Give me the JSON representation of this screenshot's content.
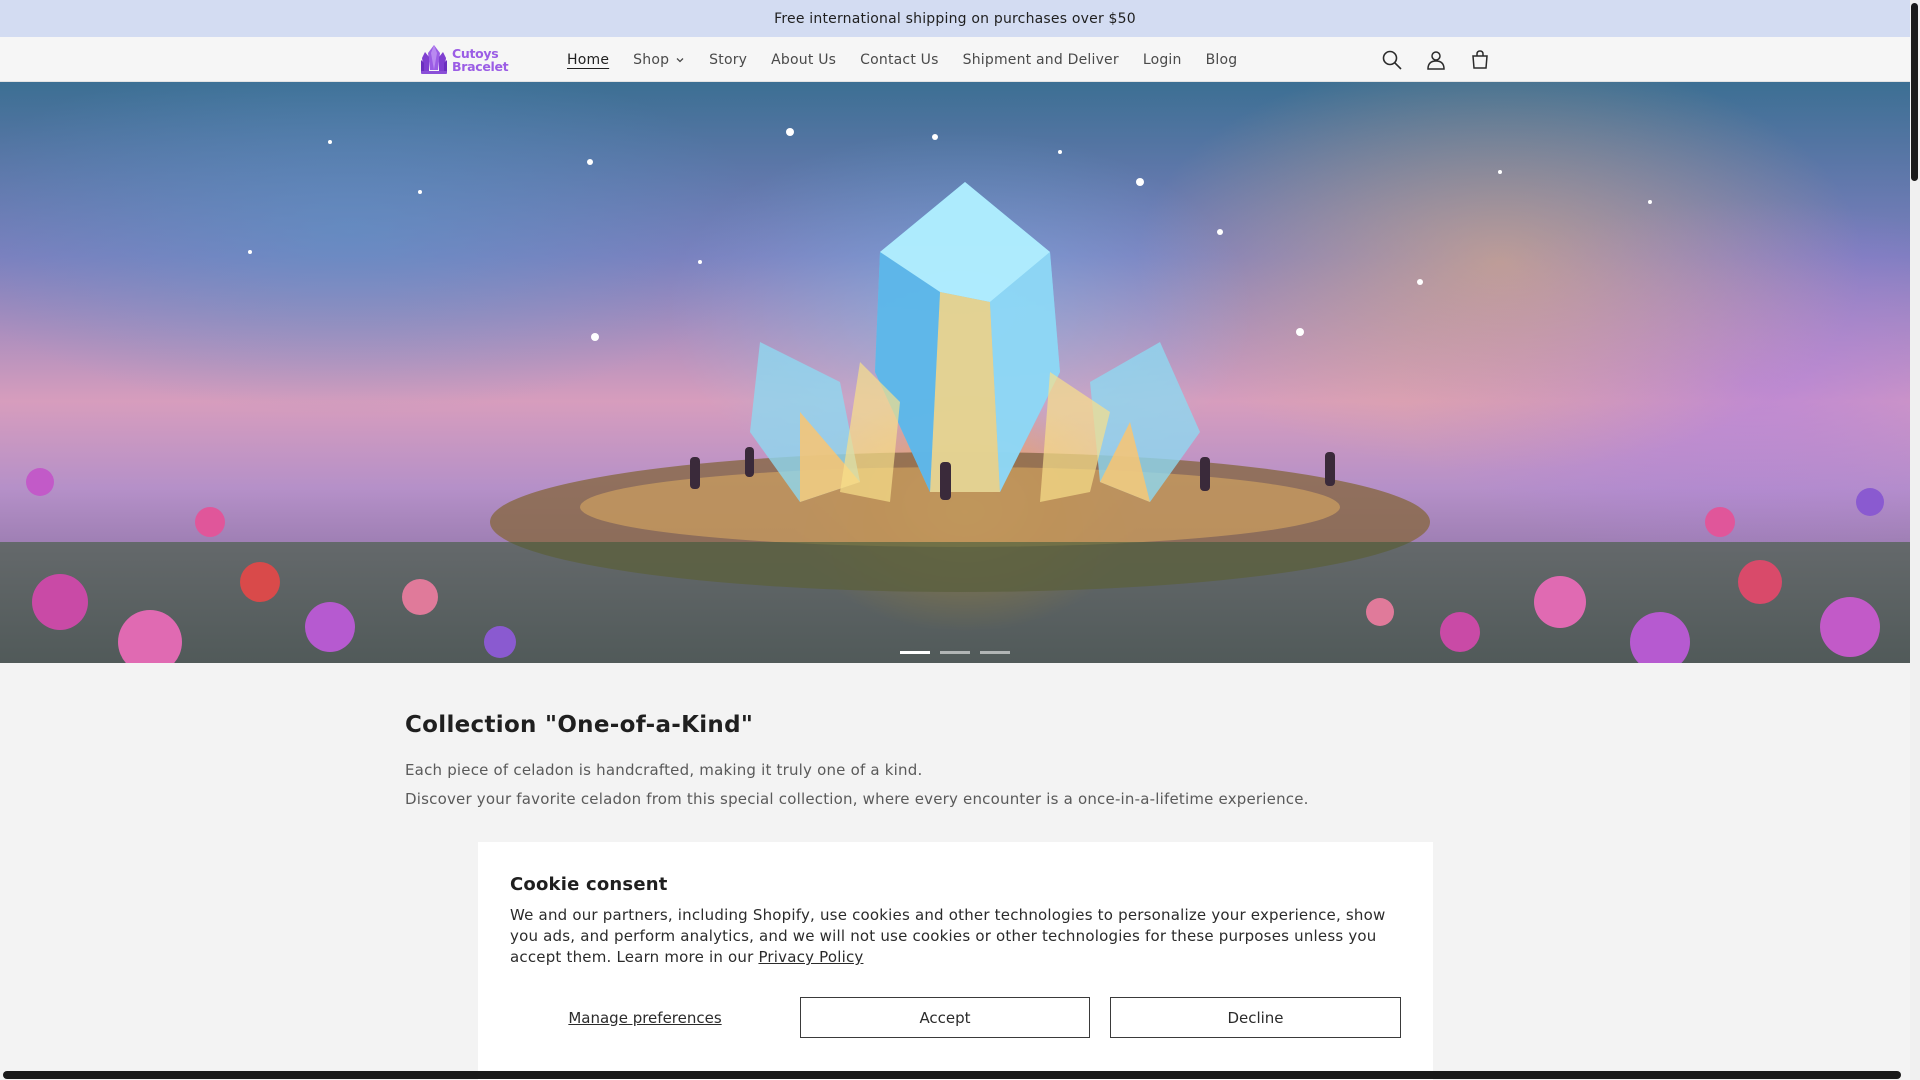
{
  "announcement": {
    "text": "Free international shipping on purchases over $50"
  },
  "header": {
    "logo": {
      "line1": "Cutoys",
      "line2": "Bracelet",
      "icon": "crystal-logo"
    },
    "nav": [
      {
        "label": "Home",
        "active": true
      },
      {
        "label": "Shop",
        "has_dropdown": true
      },
      {
        "label": "Story"
      },
      {
        "label": "About Us"
      },
      {
        "label": "Contact Us"
      },
      {
        "label": "Shipment and Deliver"
      },
      {
        "label": "Login"
      },
      {
        "label": "Blog"
      }
    ],
    "icons": [
      "search-icon",
      "account-icon",
      "cart-icon"
    ]
  },
  "hero": {
    "slides_count": 3,
    "active_slide": 1
  },
  "collection": {
    "title": "Collection \"One-of-a-Kind\"",
    "line1": "Each piece of celadon is handcrafted, making it truly one of a kind.",
    "line2": "Discover your favorite celadon from this special collection, where every encounter is a once-in-a-lifetime experience."
  },
  "cookie": {
    "title": "Cookie consent",
    "body": "We and our partners, including Shopify, use cookies and other technologies to personalize your experience, show you ads, and perform analytics, and we will not use cookies or other technologies for these purposes unless you accept them. Learn more in our",
    "privacy_link": "Privacy Policy",
    "manage_label": "Manage preferences",
    "accept_label": "Accept",
    "decline_label": "Decline"
  },
  "colors": {
    "announcement_bg": "#d3dcf2",
    "logo_purple": "#9b5de5",
    "page_bg": "#f3f3f3"
  }
}
